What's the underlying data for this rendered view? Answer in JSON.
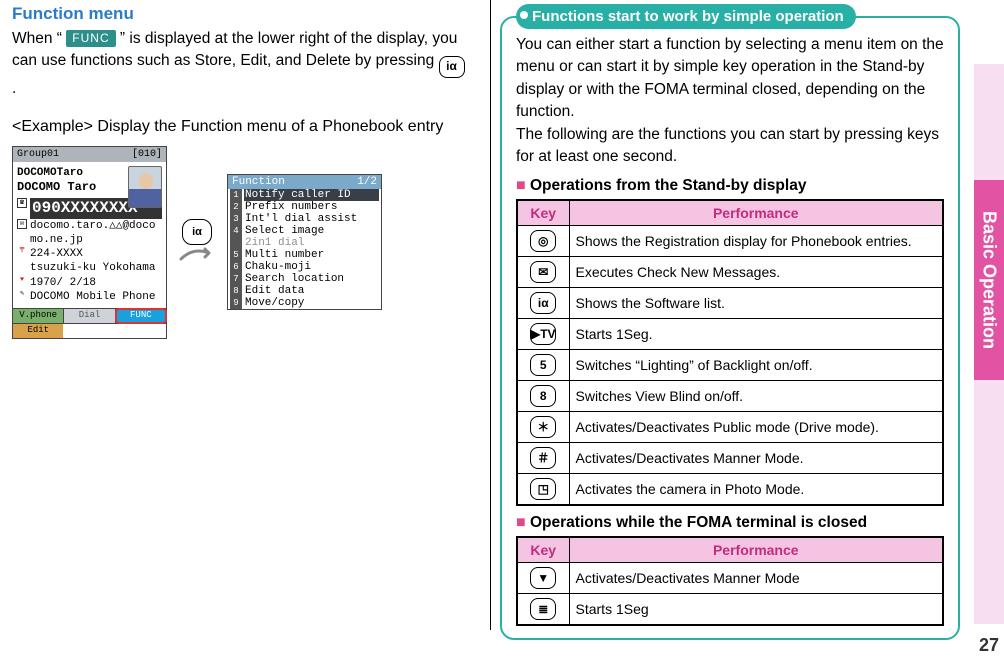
{
  "page_number": "27",
  "side_label": "Basic Operation",
  "left": {
    "title": "Function menu",
    "p1a": "When “",
    "func_label": "FUNC",
    "p1b": "” is displayed at the lower right of the display, you can use functions such as Store, Edit, and Delete by pressing ",
    "key_ir": "iα",
    "p1c": ".",
    "example_label": "<Example>",
    "example_text": "Display the Function menu of a Phonebook entry",
    "left_screen": {
      "group_left": "Group01",
      "group_right": "[010]",
      "line1": "DOCOMOTaro",
      "line2": "DOCOMO Taro",
      "entries": [
        {
          "icon": "☎",
          "text": "090XXXXXXXX",
          "big": true
        },
        {
          "icon": "✉",
          "text": "docomo.taro.△△@docomo.ne.jp"
        },
        {
          "icon": "〒",
          "text": "224-XXXX"
        },
        {
          "icon": "",
          "text": "tsuzuki-ku Yokohama"
        },
        {
          "icon": "♥",
          "text": "1970/ 2/18"
        },
        {
          "icon": "✎",
          "text": "DOCOMO Mobile Phone"
        }
      ],
      "foot_vphone": "V.phone",
      "foot_dial": "Dial",
      "foot_func": "FUNC",
      "foot_edit": "Edit"
    },
    "arrow_key": "iα",
    "right_screen": {
      "title": "Function",
      "page": "1/2",
      "items": [
        {
          "n": "1",
          "t": "Notify caller ID",
          "sel": true
        },
        {
          "n": "2",
          "t": "Prefix numbers"
        },
        {
          "n": "3",
          "t": "Int'l dial assist"
        },
        {
          "n": "4",
          "t": "Select image"
        },
        {
          "n": " ",
          "t": "2in1 dial",
          "dim": true
        },
        {
          "n": "5",
          "t": "Multi number"
        },
        {
          "n": "6",
          "t": "Chaku-moji"
        },
        {
          "n": "7",
          "t": "Search location"
        },
        {
          "n": "8",
          "t": "Edit data"
        },
        {
          "n": "9",
          "t": "Move/copy"
        }
      ]
    }
  },
  "right": {
    "callout_title": "Functions start to work by simple operation",
    "para1": "You can either start a function by selecting a menu item on the menu or can start it by simple key operation in the Stand-by display or with the FOMA terminal closed, depending on the function.",
    "para2": "The following are the functions you can start by pressing keys for at least one second.",
    "sq": "■",
    "standby_title": "Operations from the Stand-by display",
    "closed_title": "Operations while the FOMA terminal is closed",
    "table_head_key": "Key",
    "table_head_perf": "Performance",
    "standby_rows": [
      {
        "key": "◎",
        "perf": "Shows the Registration display for Phonebook entries."
      },
      {
        "key": "✉",
        "perf": "Executes Check New Messages."
      },
      {
        "key": "iα",
        "perf": "Shows the Software list."
      },
      {
        "key": "▶TV",
        "perf": "Starts 1Seg."
      },
      {
        "key": "5",
        "perf": "Switches “Lighting” of Backlight on/off."
      },
      {
        "key": "8",
        "perf": "Switches View Blind on/off."
      },
      {
        "key": "＊",
        "perf": "Activates/Deactivates Public mode (Drive mode)."
      },
      {
        "key": "＃",
        "perf": "Activates/Deactivates Manner Mode."
      },
      {
        "key": "◳",
        "perf": "Activates the camera in Photo Mode."
      }
    ],
    "closed_rows": [
      {
        "key": "▼",
        "perf": "Activates/Deactivates Manner Mode"
      },
      {
        "key": "≣",
        "perf": "Starts 1Seg"
      }
    ]
  }
}
